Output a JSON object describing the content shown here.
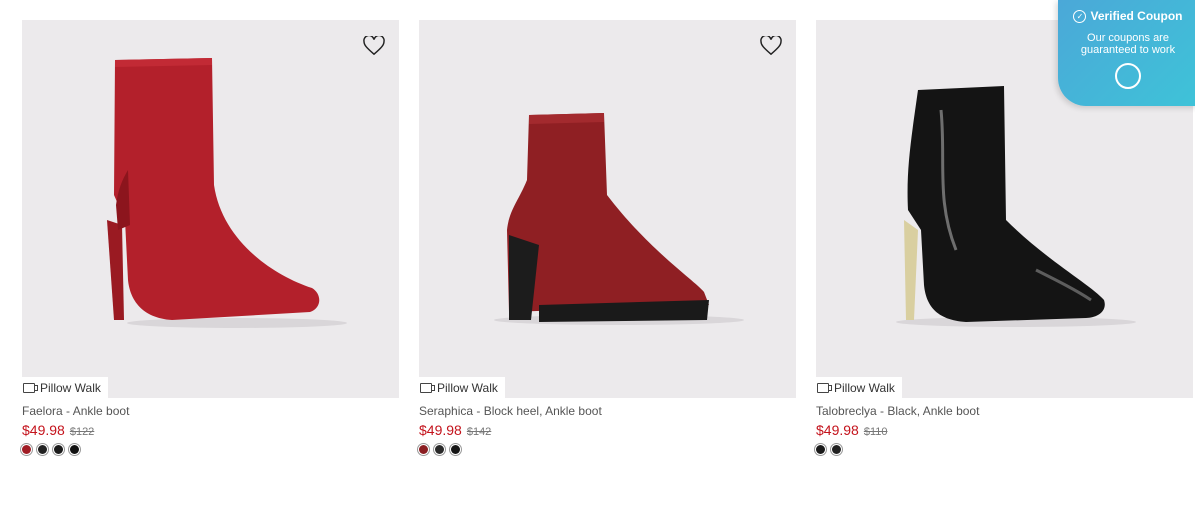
{
  "products": [
    {
      "name": "Faelora - Ankle boot",
      "badge": "Pillow Walk",
      "price": "$49.98",
      "original_price": "$122",
      "swatches": [
        "#a01c24",
        "#222222",
        "#1b1b1b",
        "#111111"
      ]
    },
    {
      "name": "Seraphica - Block heel, Ankle boot",
      "badge": "Pillow Walk",
      "price": "$49.98",
      "original_price": "$142",
      "swatches": [
        "#8b1e22",
        "#2a2a2a",
        "#151515"
      ]
    },
    {
      "name": "Talobreclya - Black, Ankle boot",
      "badge": "Pillow Walk",
      "price": "$49.98",
      "original_price": "$110",
      "swatches": [
        "#1a1a1a",
        "#222222"
      ]
    }
  ],
  "coupon": {
    "title": "Verified Coupon",
    "message": "Our coupons are guaranteed to work"
  },
  "colors": {
    "sale": "#c4131c",
    "image_bg": "#eceaec",
    "coupon": "#3ec3d8"
  }
}
